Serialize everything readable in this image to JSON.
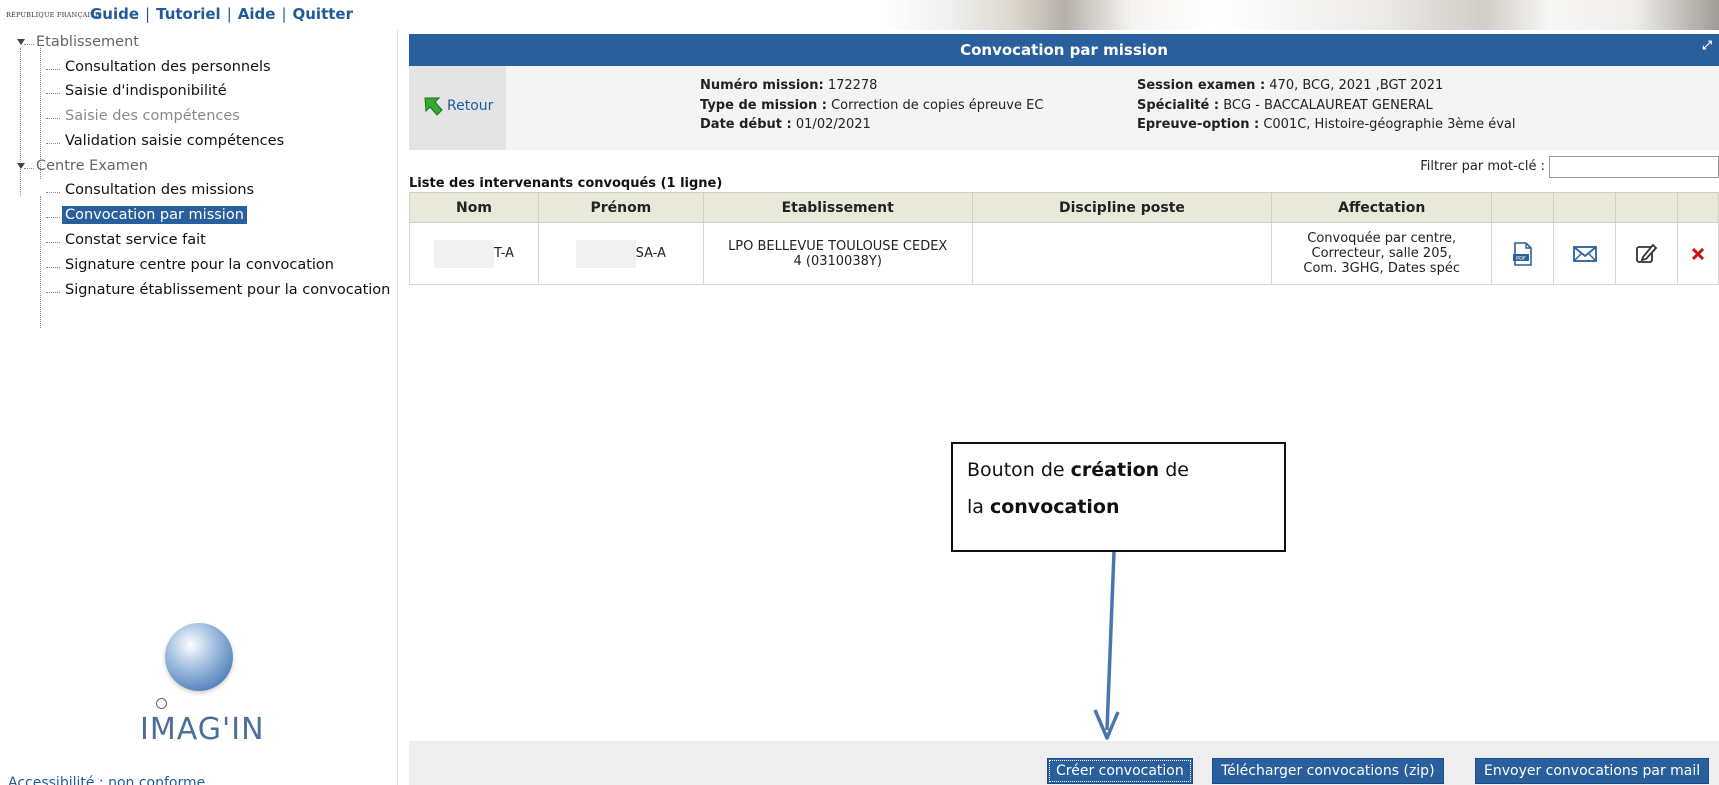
{
  "top": {
    "rf_logo": "République Française",
    "links": [
      "Guide",
      "Tutoriel",
      "Aide",
      "Quitter"
    ]
  },
  "sidebar": {
    "groups": [
      {
        "label": "Etablissement",
        "items": [
          {
            "label": "Consultation des personnels",
            "state": "normal"
          },
          {
            "label": "Saisie d'indisponibilité",
            "state": "normal"
          },
          {
            "label": "Saisie des compétences",
            "state": "disabled"
          },
          {
            "label": "Validation saisie compétences",
            "state": "normal"
          }
        ]
      },
      {
        "label": "Centre Examen",
        "items": [
          {
            "label": "Consultation des missions",
            "state": "normal"
          },
          {
            "label": "Convocation par mission",
            "state": "selected"
          },
          {
            "label": "Constat service fait",
            "state": "normal"
          },
          {
            "label": "Signature centre pour la convocation",
            "state": "normal"
          },
          {
            "label": "Signature établissement pour la convocation",
            "state": "normal"
          }
        ]
      }
    ],
    "logo_text": "IMAG'IN",
    "accessibility": "Accessibilité : non conforme"
  },
  "main": {
    "title": "Convocation par mission",
    "retour": "Retour",
    "info": {
      "col1": [
        {
          "key": "Numéro mission:",
          "value": "172278"
        },
        {
          "key": "Type de mission :",
          "value": "Correction de copies épreuve EC"
        },
        {
          "key": "Date début :",
          "value": "01/02/2021"
        }
      ],
      "col2": [
        {
          "key": "Session examen :",
          "value": "470, BCG, 2021 ,BGT 2021"
        },
        {
          "key": "Spécialité :",
          "value": "BCG - BACCALAUREAT GENERAL"
        },
        {
          "key": "Epreuve-option :",
          "value": "C001C, Histoire-géographie 3ème éval"
        }
      ]
    },
    "filter_label": "Filtrer par mot-clé :",
    "filter_value": "",
    "list_title": "Liste des intervenants convoqués (1 ligne)",
    "columns": [
      "Nom",
      "Prénom",
      "Etablissement",
      "Discipline poste",
      "Affectation",
      "",
      "",
      "",
      ""
    ],
    "rows": [
      {
        "nom": "T-A",
        "prenom": "SA-A",
        "etablissement": [
          "LPO BELLEVUE TOULOUSE CEDEX",
          "4 (0310038Y)"
        ],
        "discipline": "",
        "affectation": [
          "Convoquée par centre,",
          "Correcteur, salle 205,",
          "Com. 3GHG, Dates spéc"
        ]
      }
    ],
    "buttons": {
      "create": "Créer convocation",
      "download": "Télécharger convocations (zip)",
      "send": "Envoyer convocations par mail"
    }
  },
  "callout": {
    "line1_a": "Bouton de ",
    "line1_b": "création",
    "line1_c": " de",
    "line2_a": "la ",
    "line2_b": "convocation"
  },
  "colors": {
    "primary_blue": "#2a5f9d",
    "header_bg": "#e9e9db",
    "delete_red": "#cc1111"
  }
}
